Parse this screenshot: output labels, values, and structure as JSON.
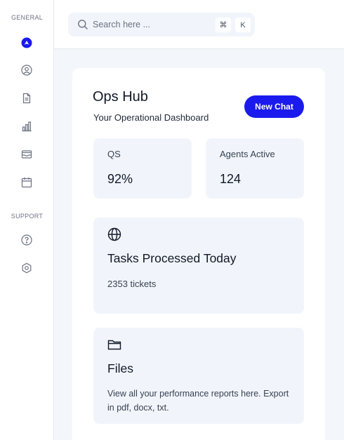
{
  "sidebar": {
    "general_label": "GENERAL",
    "support_label": "SUPPORT",
    "items": [
      {
        "icon": "home-icon",
        "active": true
      },
      {
        "icon": "user-icon"
      },
      {
        "icon": "document-icon"
      },
      {
        "icon": "bar-chart-icon"
      },
      {
        "icon": "inbox-icon"
      },
      {
        "icon": "calendar-icon"
      }
    ],
    "support_items": [
      {
        "icon": "help-icon"
      },
      {
        "icon": "settings-icon"
      }
    ]
  },
  "search": {
    "placeholder": "Search here ...",
    "shortcut_keys": [
      "⌘",
      "K"
    ]
  },
  "header": {
    "title": "Ops Hub",
    "subtitle": "Your Operational Dashboard",
    "new_chat_label": "New Chat"
  },
  "stats": [
    {
      "label": "QS",
      "value": "92%"
    },
    {
      "label": "Agents Active",
      "value": "124"
    }
  ],
  "tasks": {
    "icon": "globe-icon",
    "title": "Tasks Processed Today",
    "value": "2353 tickets"
  },
  "files": {
    "icon": "folder-icon",
    "title": "Files",
    "description": "View all your performance reports here. Export in pdf, docx, txt."
  },
  "colors": {
    "accent": "#1a1aee",
    "card_background": "#f1f5fb",
    "page_background": "#f3f6fb"
  }
}
